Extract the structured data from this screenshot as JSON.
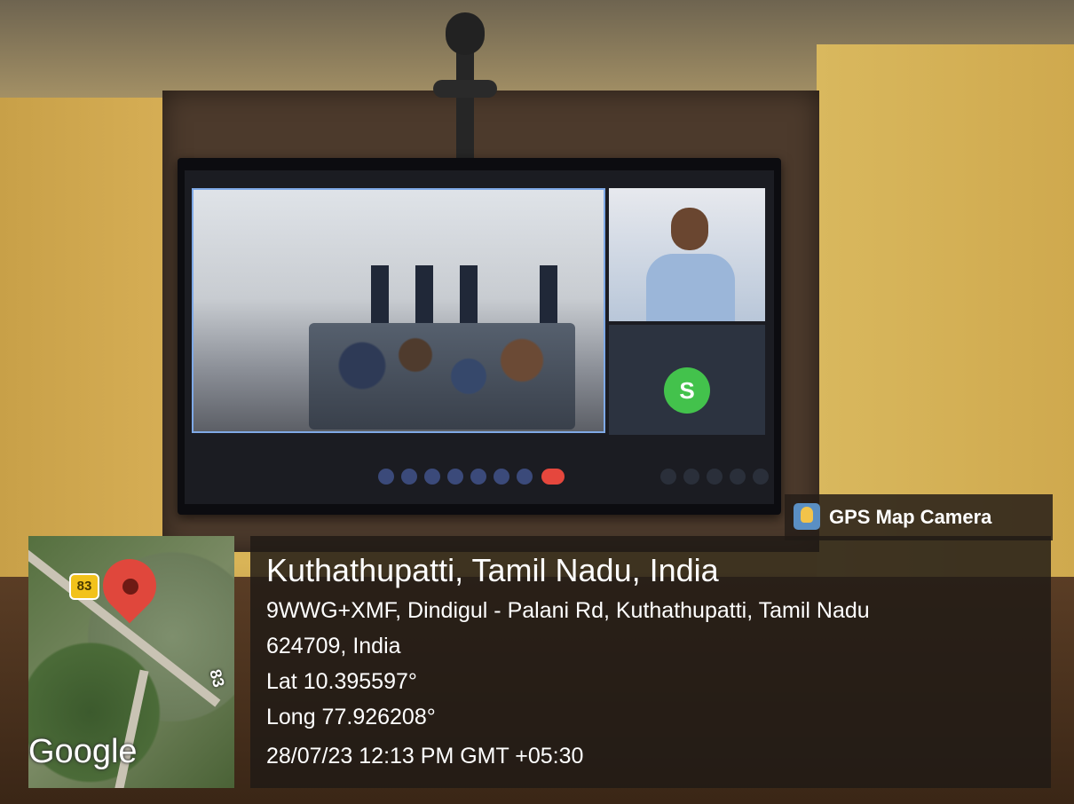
{
  "badge": {
    "app_name": "GPS Map Camera",
    "logo": "gps-map-camera-logo-icon"
  },
  "map": {
    "route_shield_top": "83",
    "route_shield_side": "83",
    "brand": "Google",
    "marker": "map-pin-icon"
  },
  "location": {
    "place": "Kuthathupatti, Tamil Nadu, India",
    "address_line_1": "9WWG+XMF, Dindigul - Palani Rd, Kuthathupatti, Tamil Nadu",
    "address_line_2": "624709, India",
    "lat": "Lat 10.395597°",
    "long": "Long 77.926208°",
    "datetime": "28/07/23 12:13 PM GMT +05:30"
  },
  "video_call": {
    "participant_avatar_initial": "S"
  },
  "colors": {
    "end_call": "#e5473d",
    "avatar": "#43c24c",
    "map_pin": "#e0473c"
  }
}
